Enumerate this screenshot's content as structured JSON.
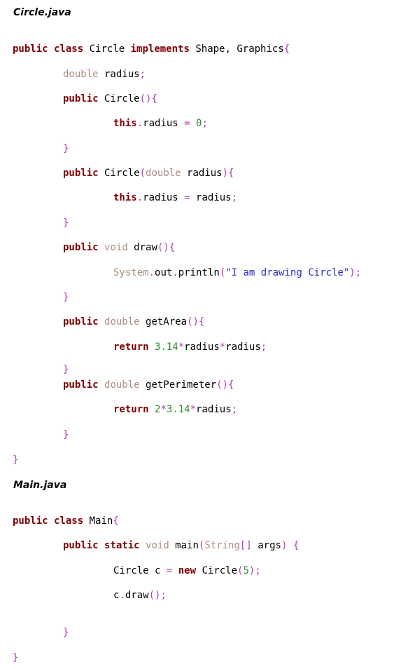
{
  "files": [
    {
      "title": "Circle.java",
      "lines": [
        [
          {
            "t": "public",
            "c": "kw"
          },
          {
            "t": " "
          },
          {
            "t": "class",
            "c": "kw"
          },
          {
            "t": " Circle "
          },
          {
            "t": "implements",
            "c": "kw"
          },
          {
            "t": " Shape, Graphics"
          },
          {
            "t": "{",
            "c": "pn"
          }
        ],
        [
          {
            "t": "double",
            "c": "ty"
          },
          {
            "t": " radius"
          },
          {
            "t": ";",
            "c": "pn"
          }
        ],
        [
          {
            "t": "public",
            "c": "kw"
          },
          {
            "t": " Circle"
          },
          {
            "t": "(){",
            "c": "pn"
          }
        ],
        [
          {
            "t": "this",
            "c": "kw"
          },
          {
            "t": ".",
            "c": "pn"
          },
          {
            "t": "radius "
          },
          {
            "t": "=",
            "c": "pn"
          },
          {
            "t": " "
          },
          {
            "t": "0",
            "c": "nm"
          },
          {
            "t": ";",
            "c": "pn"
          }
        ],
        [
          {
            "t": "}",
            "c": "pn"
          }
        ],
        [
          {
            "t": "public",
            "c": "kw"
          },
          {
            "t": " Circle"
          },
          {
            "t": "(",
            "c": "pn"
          },
          {
            "t": "double",
            "c": "ty"
          },
          {
            "t": " radius"
          },
          {
            "t": "){",
            "c": "pn"
          }
        ],
        [
          {
            "t": "this",
            "c": "kw"
          },
          {
            "t": ".",
            "c": "pn"
          },
          {
            "t": "radius "
          },
          {
            "t": "=",
            "c": "pn"
          },
          {
            "t": " radius"
          },
          {
            "t": ";",
            "c": "pn"
          }
        ],
        [
          {
            "t": "}",
            "c": "pn"
          }
        ],
        [
          {
            "t": "public",
            "c": "kw"
          },
          {
            "t": " "
          },
          {
            "t": "void",
            "c": "ty"
          },
          {
            "t": " draw"
          },
          {
            "t": "(){",
            "c": "pn"
          }
        ],
        [
          {
            "t": "System",
            "c": "ty"
          },
          {
            "t": ".",
            "c": "pn"
          },
          {
            "t": "out"
          },
          {
            "t": ".",
            "c": "pn"
          },
          {
            "t": "println"
          },
          {
            "t": "(",
            "c": "pn"
          },
          {
            "t": "\"I am drawing Circle\"",
            "c": "st"
          },
          {
            "t": ");",
            "c": "pn"
          }
        ],
        [
          {
            "t": "}",
            "c": "pn"
          }
        ],
        [
          {
            "t": "public",
            "c": "kw"
          },
          {
            "t": " "
          },
          {
            "t": "double",
            "c": "ty"
          },
          {
            "t": " getArea"
          },
          {
            "t": "(){",
            "c": "pn"
          }
        ],
        [
          {
            "t": "return",
            "c": "kw"
          },
          {
            "t": " "
          },
          {
            "t": "3.14",
            "c": "nm"
          },
          {
            "t": "*",
            "c": "pn"
          },
          {
            "t": "radius"
          },
          {
            "t": "*",
            "c": "pn"
          },
          {
            "t": "radius"
          },
          {
            "t": ";",
            "c": "pn"
          }
        ],
        [
          {
            "t": "}",
            "c": "pn"
          }
        ],
        [
          {
            "t": "public",
            "c": "kw"
          },
          {
            "t": " "
          },
          {
            "t": "double",
            "c": "ty"
          },
          {
            "t": " getPerimeter"
          },
          {
            "t": "(){",
            "c": "pn"
          }
        ],
        [
          {
            "t": "return",
            "c": "kw"
          },
          {
            "t": " "
          },
          {
            "t": "2",
            "c": "nm"
          },
          {
            "t": "*",
            "c": "pn"
          },
          {
            "t": "3.14",
            "c": "nm"
          },
          {
            "t": "*",
            "c": "pn"
          },
          {
            "t": "radius"
          },
          {
            "t": ";",
            "c": "pn"
          }
        ],
        [
          {
            "t": "}",
            "c": "pn"
          }
        ],
        [
          {
            "t": "}",
            "c": "pn"
          }
        ]
      ]
    },
    {
      "title": "Main.java",
      "lines": [
        [
          {
            "t": "public",
            "c": "kw"
          },
          {
            "t": " "
          },
          {
            "t": "class",
            "c": "kw"
          },
          {
            "t": " Main"
          },
          {
            "t": "{",
            "c": "pn"
          }
        ],
        [
          {
            "t": "public",
            "c": "kw"
          },
          {
            "t": " "
          },
          {
            "t": "static",
            "c": "kw"
          },
          {
            "t": " "
          },
          {
            "t": "void",
            "c": "ty"
          },
          {
            "t": " main"
          },
          {
            "t": "(",
            "c": "pn"
          },
          {
            "t": "String",
            "c": "ty"
          },
          {
            "t": "[]",
            "c": "pn"
          },
          {
            "t": " args"
          },
          {
            "t": ")",
            "c": "pn"
          },
          {
            "t": " "
          },
          {
            "t": "{",
            "c": "pn"
          }
        ],
        [
          {
            "t": "Circle c "
          },
          {
            "t": "=",
            "c": "pn"
          },
          {
            "t": " "
          },
          {
            "t": "new",
            "c": "kw"
          },
          {
            "t": " Circle"
          },
          {
            "t": "(",
            "c": "pn"
          },
          {
            "t": "5",
            "c": "nm"
          },
          {
            "t": ");",
            "c": "pn"
          }
        ],
        [
          {
            "t": "c"
          },
          {
            "t": ".",
            "c": "pn"
          },
          {
            "t": "draw"
          },
          {
            "t": "();",
            "c": "pn"
          }
        ],
        [
          {
            "t": "}",
            "c": "pn"
          }
        ],
        [
          {
            "t": "}",
            "c": "pn"
          }
        ]
      ]
    }
  ],
  "colors": {
    "keyword": "#7f0000",
    "type": "#b08a80",
    "string": "#2a2ad0",
    "number": "#2e8b2e",
    "punctuation": "#b040b0",
    "plain": "#000000"
  }
}
